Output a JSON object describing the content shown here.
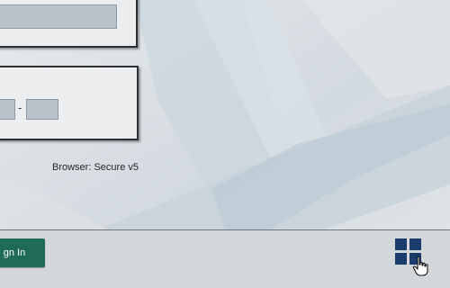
{
  "app": {
    "browser_label": "Browser: Secure v5"
  },
  "login": {
    "username_value": "",
    "code_segment_1_value": "",
    "code_segment_2_value": "",
    "code_separator": "-"
  },
  "taskbar": {
    "signin_label": "gn In",
    "apps_icon": "grid-icon",
    "cursor_icon": "hand-cursor-icon"
  },
  "colors": {
    "background": "#d9dde1",
    "signin_button": "#1f6b57",
    "apps_icon": "#1a3c6d"
  }
}
